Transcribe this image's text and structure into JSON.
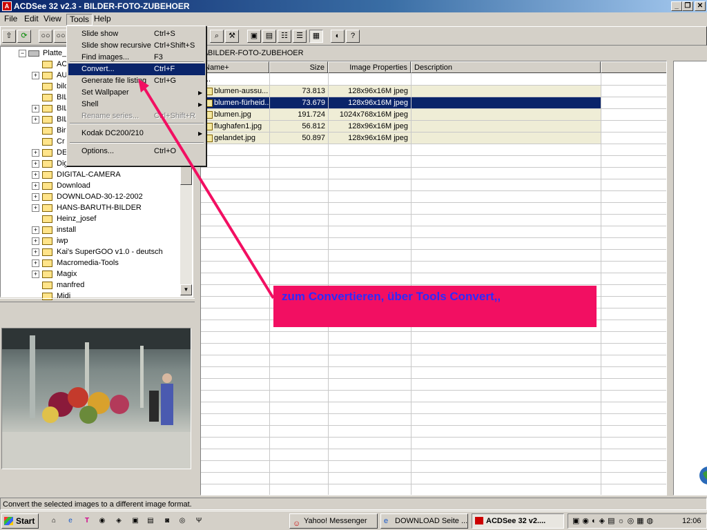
{
  "window": {
    "title": "ACDSee 32 v2.3 - BILDER-FOTO-ZUBEHOER",
    "app_icon": "acdsee-icon"
  },
  "menubar": [
    "File",
    "Edit",
    "View",
    "Tools",
    "Help"
  ],
  "tools_menu": [
    {
      "label": "Slide show",
      "shortcut": "Ctrl+S"
    },
    {
      "label": "Slide show recursive",
      "shortcut": "Ctrl+Shift+S"
    },
    {
      "label": "Find images...",
      "shortcut": "F3"
    },
    {
      "label": "Convert...",
      "shortcut": "Ctrl+F"
    },
    {
      "label": "Generate file listing",
      "shortcut": "Ctrl+G"
    },
    {
      "label": "Set Wallpaper",
      "shortcut": ""
    },
    {
      "label": "Shell",
      "shortcut": ""
    },
    {
      "label": "Rename series...",
      "shortcut": "Ctrl+Shift+R"
    },
    {
      "label": "Kodak DC200/210",
      "shortcut": ""
    },
    {
      "label": "Options...",
      "shortcut": "Ctrl+O"
    }
  ],
  "tree": {
    "root": "Platte_",
    "items": [
      "ACI",
      "AU",
      "bild",
      "BIL",
      "BIL",
      "BIL",
      "Bir",
      "Cr",
      "DE",
      "Digit",
      "DIGITAL-CAMERA",
      "Download",
      "DOWNLOAD-30-12-2002",
      "HANS-BARUTH-BILDER",
      "Heinz_josef",
      "install",
      "iwp",
      "Kai's SuperGOO v1.0 - deutsch",
      "Macromedia-Tools",
      "Magix",
      "manfred",
      "Midi"
    ]
  },
  "path": "\\BILDER-FOTO-ZUBEHOER",
  "columns": [
    "Name",
    "Size",
    "Image Properties",
    "Description"
  ],
  "up_entry": "..",
  "files": [
    {
      "name": "blumen-aussu...",
      "size": "73.813",
      "props": "128x96x16M jpeg"
    },
    {
      "name": "blumen-fürheid...",
      "size": "73.679",
      "props": "128x96x16M jpeg"
    },
    {
      "name": "blumen.jpg",
      "size": "191.724",
      "props": "1024x768x16M jpeg"
    },
    {
      "name": "flughafen1.jpg",
      "size": "56.812",
      "props": "128x96x16M jpeg"
    },
    {
      "name": "gelandet.jpg",
      "size": "50.897",
      "props": "128x96x16M jpeg"
    }
  ],
  "annotation": "zum Convertieren, über Tools Convert,,",
  "status": "Convert the selected images to a different image format.",
  "taskbar": {
    "start": "Start",
    "tasks": [
      "Yahoo! Messenger",
      "DOWNLOAD Seite ...",
      "ACDSee 32 v2...."
    ],
    "clock": "12:06"
  },
  "colors": {
    "menu_highlight": "#0a246a",
    "row_highlight": "#efedd6",
    "callout": "#f20f62",
    "callout_text": "#2b2bff"
  }
}
